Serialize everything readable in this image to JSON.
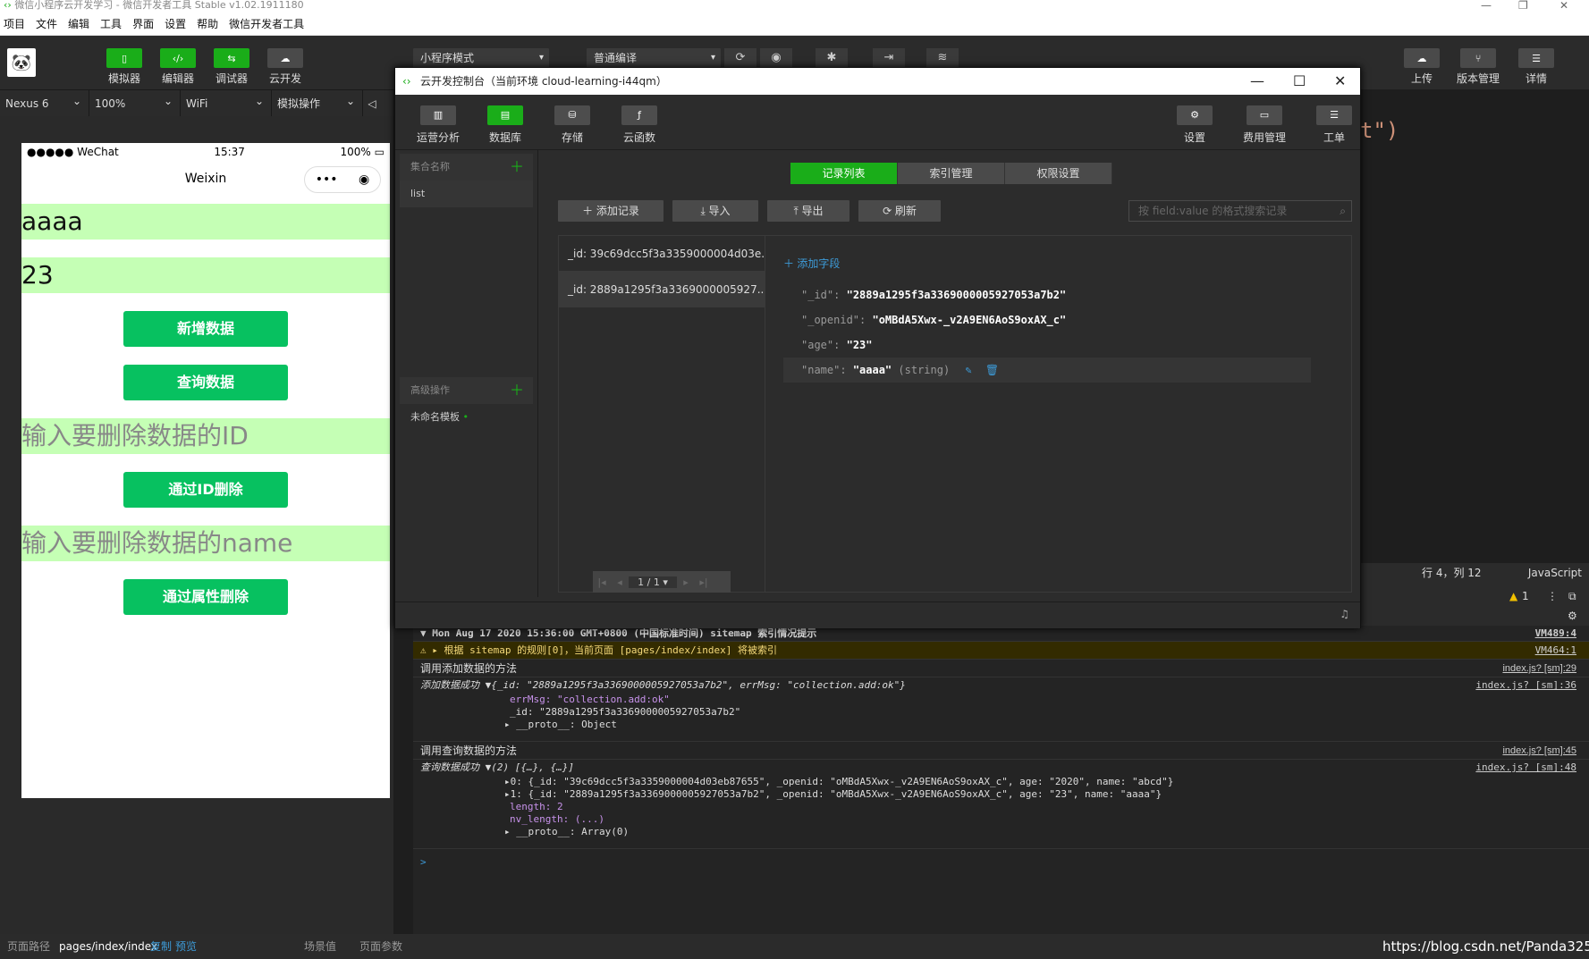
{
  "window": {
    "title": "微信小程序云开发学习 - 微信开发者工具 Stable v1.02.1911180"
  },
  "menu": [
    "项目",
    "文件",
    "编辑",
    "工具",
    "界面",
    "设置",
    "帮助",
    "微信开发者工具"
  ],
  "toolbar": {
    "left": [
      {
        "label": "模拟器",
        "icon": "phone-icon"
      },
      {
        "label": "编辑器",
        "icon": "code-icon"
      },
      {
        "label": "调试器",
        "icon": "debug-icon"
      },
      {
        "label": "云开发",
        "icon": "cloud-icon"
      }
    ],
    "mode_select": "小程序模式",
    "compile_select": "普通编译",
    "right": [
      {
        "label": "上传",
        "icon": "upload-icon"
      },
      {
        "label": "版本管理",
        "icon": "branch-icon"
      },
      {
        "label": "详情",
        "icon": "menu-icon"
      }
    ]
  },
  "devbar": {
    "device": "Nexus 6",
    "zoom": "100%",
    "network": "WiFi",
    "ops": "模拟操作"
  },
  "phone": {
    "status": {
      "carrier": "●●●●● WeChat",
      "time": "15:37",
      "battery": "100%"
    },
    "nav_title": "Weixin",
    "inputs": [
      "aaaa",
      "23"
    ],
    "buttons": [
      "新增数据",
      "查询数据",
      "通过ID删除",
      "通过属性删除"
    ],
    "placeholders": [
      "输入要删除数据的ID",
      "输入要删除数据的name"
    ]
  },
  "editor": {
    "code_tail": "t\")",
    "cursor": "行 4，列 12",
    "lang": "JavaScript",
    "warn": "1"
  },
  "cloud": {
    "title": "云开发控制台（当前环境 cloud-learning-i44qm）",
    "tools": [
      "运营分析",
      "数据库",
      "存储",
      "云函数"
    ],
    "tools_right": [
      "设置",
      "费用管理",
      "工单"
    ],
    "side_collections_head": "集合名称",
    "collections": [
      "list"
    ],
    "side_adv_head": "高级操作",
    "adv_items": [
      "未命名模板"
    ],
    "tabs": [
      "记录列表",
      "索引管理",
      "权限设置"
    ],
    "actions": [
      "＋ 添加记录",
      "⤓ 导入",
      "⤒ 导出",
      "⟳ 刷新"
    ],
    "search_placeholder": "按 field:value 的格式搜索记录",
    "records": [
      "_id: 39c69dcc5f3a3359000004d03e...",
      "_id: 2889a1295f3a3369000005927..."
    ],
    "pager": "1 / 1",
    "add_field": "添加字段",
    "fields": [
      {
        "key": "\"_id\":",
        "value": "\"2889a1295f3a3369000005927053a7b2\""
      },
      {
        "key": "\"_openid\":",
        "value": "\"oMBdA5Xwx-_v2A9EN6AoS9oxAX_c\""
      },
      {
        "key": "\"age\":",
        "value": "\"23\""
      },
      {
        "key": "\"name\":",
        "value": "\"aaaa\"",
        "type": "(string)"
      }
    ]
  },
  "console": {
    "rows": [
      {
        "text": "▼ Mon Aug 17 2020 15:36:00 GMT+0800 (中国标准时间) sitemap 索引情况提示",
        "link": "VM489:4"
      },
      {
        "text": "⚠ ▸ 根据 sitemap 的规则[0]，当前页面 [pages/index/index] 将被索引",
        "link": "VM464:1"
      },
      {
        "text": "调用添加数据的方法",
        "link": "index.js? [sm]:29"
      },
      {
        "text": "添加数据成功 ▼{_id: \"2889a1295f3a3369000005927053a7b2\", errMsg: \"collection.add:ok\"}",
        "link": "index.js? [sm]:36"
      },
      {
        "text": "errMsg: \"collection.add:ok\""
      },
      {
        "text": "_id: \"2889a1295f3a3369000005927053a7b2\""
      },
      {
        "text": "▸ __proto__: Object"
      },
      {
        "text": "调用查询数据的方法",
        "link": "index.js? [sm]:45"
      },
      {
        "text": "查询数据成功 ▼(2) [{…}, {…}]",
        "link": "index.js? [sm]:48"
      },
      {
        "text": "▸0: {_id: \"39c69dcc5f3a3359000004d03eb87655\", _openid: \"oMBdA5Xwx-_v2A9EN6AoS9oxAX_c\", age: \"2020\", name: \"abcd\"}"
      },
      {
        "text": "▸1: {_id: \"2889a1295f3a3369000005927053a7b2\", _openid: \"oMBdA5Xwx-_v2A9EN6AoS9oxAX_c\", age: \"23\", name: \"aaaa\"}"
      },
      {
        "text": "length: 2"
      },
      {
        "text": "nv_length: (...)"
      },
      {
        "text": "▸ __proto__: Array(0)"
      }
    ],
    "prompt": ">"
  },
  "bottom": {
    "path_label": "页面路径",
    "path": "pages/index/index",
    "copy": "复制",
    "preview": "预览",
    "scene": "场景值",
    "params": "页面参数",
    "watermark": "https://blog.csdn.net/Panda325"
  }
}
